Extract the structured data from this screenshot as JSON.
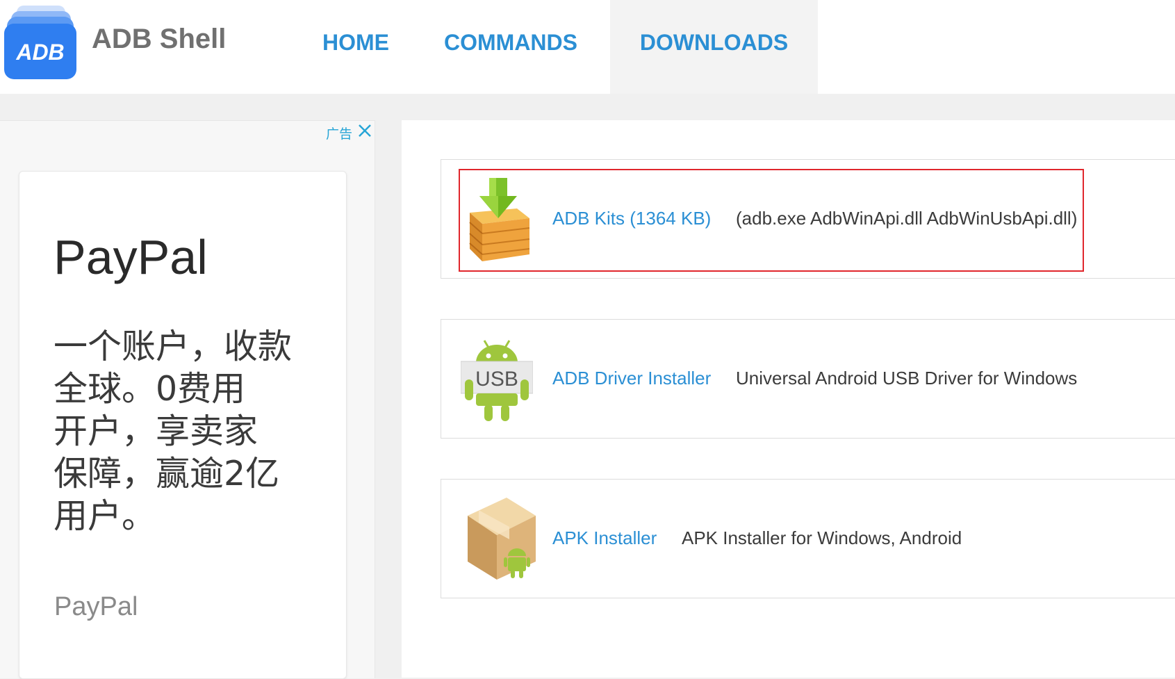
{
  "header": {
    "logo_text": "ADB",
    "site_name": "ADB Shell",
    "nav": [
      {
        "label": "HOME"
      },
      {
        "label": "COMMANDS"
      },
      {
        "label": "DOWNLOADS",
        "active": true
      }
    ]
  },
  "ad": {
    "label": "广告",
    "brand_title": "PayPal",
    "body_lines": [
      "一个账户，收款",
      "全球。0费用",
      "开户，享卖家",
      "保障，赢逾2亿",
      "用户。"
    ],
    "sponsor": "PayPal"
  },
  "downloads": [
    {
      "name": "ADB Kits (1364 KB)",
      "description": "(adb.exe AdbWinApi.dll AdbWinUsbApi.dll)",
      "icon": "box-download-icon",
      "highlighted": true
    },
    {
      "name": "ADB Driver Installer",
      "description": "Universal Android USB Driver for Windows",
      "icon": "android-usb-icon",
      "icon_text": "USB"
    },
    {
      "name": "APK Installer",
      "description": "APK Installer for Windows, Android",
      "icon": "apk-box-icon"
    }
  ],
  "colors": {
    "link": "#2b8fd4",
    "highlight_border": "#e0262c",
    "android_green": "#9fc63d",
    "logo_blue": "#2f7ef0"
  }
}
